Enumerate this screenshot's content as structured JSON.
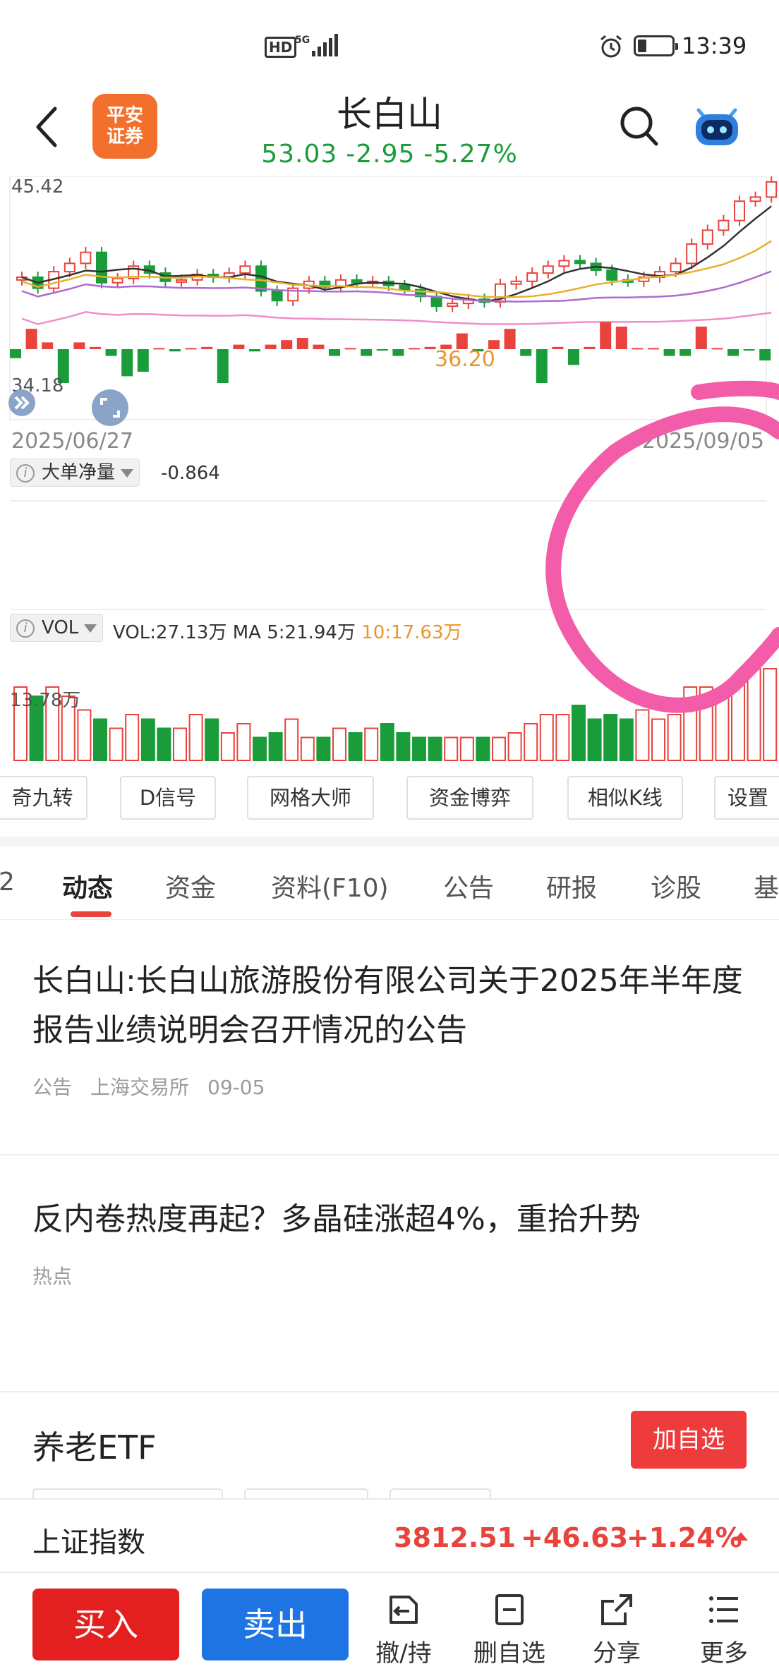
{
  "status_bar": {
    "hd": "HD",
    "network": "5G",
    "time": "13:39"
  },
  "header": {
    "logo_text": "平安证券",
    "title": "长白山",
    "price": "53.03",
    "change": "-2.95",
    "change_pct": "-5.27%"
  },
  "colors": {
    "up": "#e8433c",
    "down": "#1a9c3a",
    "accent": "#e8433c",
    "buy": "#e41f1f",
    "sell": "#1e74e3"
  },
  "chart": {
    "price_high_label": "45.42",
    "price_low_label": "34.18",
    "ma_point_label": "36.20",
    "start_date": "2025/06/27",
    "end_date": "2025/09/05",
    "big_order_label": "大单净量",
    "big_order_value": "-0.864",
    "vol_label": "VOL",
    "vol_value": "VOL:27.13万",
    "vol_ma5": "MA 5:21.94万",
    "vol_ma10": "10:17.63万",
    "vol_axis_label": "13.78万"
  },
  "chart_data": {
    "type": "candlestick",
    "x_range": [
      "2025/06/27",
      "2025/09/05"
    ],
    "y_range": [
      34.18,
      45.42
    ],
    "last_close": 53.03
  },
  "tools": [
    "奇九转",
    "D信号",
    "网格大师",
    "资金博弈",
    "相似K线",
    "设置"
  ],
  "tabs": {
    "partial": "2",
    "items": [
      "动态",
      "资金",
      "资料(F10)",
      "公告",
      "研报",
      "诊股",
      "基"
    ],
    "active": "动态"
  },
  "news": [
    {
      "title": "长白山:长白山旅游股份有限公司关于2025年半年度报告业绩说明会召开情况的公告",
      "tag": "公告",
      "source": "上海交易所",
      "date": "09-05"
    },
    {
      "title": "反内卷热度再起？多晶硅涨超4%，重拾升势",
      "tag": "热点"
    }
  ],
  "etf": {
    "title": "养老ETF",
    "add_label": "加自选"
  },
  "index_bar": {
    "name": "上证指数",
    "value": "3812.51",
    "change": "+46.63",
    "change_pct": "+1.24%"
  },
  "actions": {
    "buy": "买入",
    "sell": "卖出",
    "items": [
      {
        "label": "撤/持",
        "icon": "cancel-hold-icon"
      },
      {
        "label": "删自选",
        "icon": "remove-watchlist-icon"
      },
      {
        "label": "分享",
        "icon": "share-icon"
      },
      {
        "label": "更多",
        "icon": "more-menu-icon"
      }
    ]
  }
}
